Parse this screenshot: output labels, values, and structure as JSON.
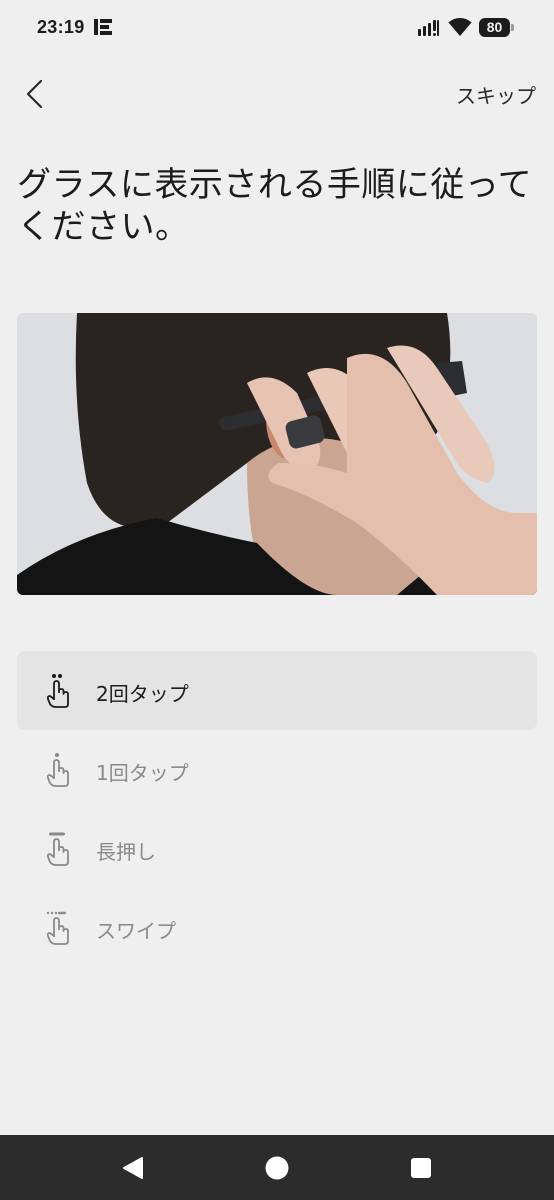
{
  "status_bar": {
    "time": "23:19",
    "battery": "80"
  },
  "header": {
    "back_icon": "chevron-left-icon",
    "skip_label": "スキップ"
  },
  "title": "グラスに表示される手順に従ってください。",
  "illustration": {
    "icon": "person-wearing-smart-glasses-photo"
  },
  "gestures": [
    {
      "label": "2回タップ",
      "icon": "double-tap-icon",
      "selected": true
    },
    {
      "label": "1回タップ",
      "icon": "single-tap-icon",
      "selected": false
    },
    {
      "label": "長押し",
      "icon": "long-press-icon",
      "selected": false
    },
    {
      "label": "スワイプ",
      "icon": "swipe-icon",
      "selected": false
    }
  ],
  "nav_bar": {
    "back_icon": "triangle-back-icon",
    "home_icon": "circle-home-icon",
    "recents_icon": "square-recents-icon"
  },
  "colors": {
    "background": "#efefef",
    "selected_row": "#e4e4e4",
    "muted_text": "#8a8a8a",
    "nav_bar": "#2c2c2c"
  }
}
